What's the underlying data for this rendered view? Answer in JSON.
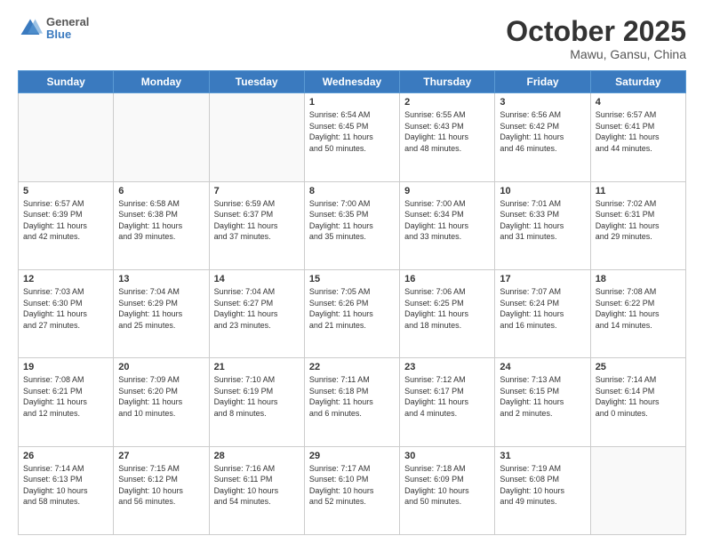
{
  "header": {
    "logo": {
      "line1": "General",
      "line2": "Blue"
    },
    "title": "October 2025",
    "location": "Mawu, Gansu, China"
  },
  "weekdays": [
    "Sunday",
    "Monday",
    "Tuesday",
    "Wednesday",
    "Thursday",
    "Friday",
    "Saturday"
  ],
  "weeks": [
    [
      {
        "day": "",
        "info": ""
      },
      {
        "day": "",
        "info": ""
      },
      {
        "day": "",
        "info": ""
      },
      {
        "day": "1",
        "info": "Sunrise: 6:54 AM\nSunset: 6:45 PM\nDaylight: 11 hours\nand 50 minutes."
      },
      {
        "day": "2",
        "info": "Sunrise: 6:55 AM\nSunset: 6:43 PM\nDaylight: 11 hours\nand 48 minutes."
      },
      {
        "day": "3",
        "info": "Sunrise: 6:56 AM\nSunset: 6:42 PM\nDaylight: 11 hours\nand 46 minutes."
      },
      {
        "day": "4",
        "info": "Sunrise: 6:57 AM\nSunset: 6:41 PM\nDaylight: 11 hours\nand 44 minutes."
      }
    ],
    [
      {
        "day": "5",
        "info": "Sunrise: 6:57 AM\nSunset: 6:39 PM\nDaylight: 11 hours\nand 42 minutes."
      },
      {
        "day": "6",
        "info": "Sunrise: 6:58 AM\nSunset: 6:38 PM\nDaylight: 11 hours\nand 39 minutes."
      },
      {
        "day": "7",
        "info": "Sunrise: 6:59 AM\nSunset: 6:37 PM\nDaylight: 11 hours\nand 37 minutes."
      },
      {
        "day": "8",
        "info": "Sunrise: 7:00 AM\nSunset: 6:35 PM\nDaylight: 11 hours\nand 35 minutes."
      },
      {
        "day": "9",
        "info": "Sunrise: 7:00 AM\nSunset: 6:34 PM\nDaylight: 11 hours\nand 33 minutes."
      },
      {
        "day": "10",
        "info": "Sunrise: 7:01 AM\nSunset: 6:33 PM\nDaylight: 11 hours\nand 31 minutes."
      },
      {
        "day": "11",
        "info": "Sunrise: 7:02 AM\nSunset: 6:31 PM\nDaylight: 11 hours\nand 29 minutes."
      }
    ],
    [
      {
        "day": "12",
        "info": "Sunrise: 7:03 AM\nSunset: 6:30 PM\nDaylight: 11 hours\nand 27 minutes."
      },
      {
        "day": "13",
        "info": "Sunrise: 7:04 AM\nSunset: 6:29 PM\nDaylight: 11 hours\nand 25 minutes."
      },
      {
        "day": "14",
        "info": "Sunrise: 7:04 AM\nSunset: 6:27 PM\nDaylight: 11 hours\nand 23 minutes."
      },
      {
        "day": "15",
        "info": "Sunrise: 7:05 AM\nSunset: 6:26 PM\nDaylight: 11 hours\nand 21 minutes."
      },
      {
        "day": "16",
        "info": "Sunrise: 7:06 AM\nSunset: 6:25 PM\nDaylight: 11 hours\nand 18 minutes."
      },
      {
        "day": "17",
        "info": "Sunrise: 7:07 AM\nSunset: 6:24 PM\nDaylight: 11 hours\nand 16 minutes."
      },
      {
        "day": "18",
        "info": "Sunrise: 7:08 AM\nSunset: 6:22 PM\nDaylight: 11 hours\nand 14 minutes."
      }
    ],
    [
      {
        "day": "19",
        "info": "Sunrise: 7:08 AM\nSunset: 6:21 PM\nDaylight: 11 hours\nand 12 minutes."
      },
      {
        "day": "20",
        "info": "Sunrise: 7:09 AM\nSunset: 6:20 PM\nDaylight: 11 hours\nand 10 minutes."
      },
      {
        "day": "21",
        "info": "Sunrise: 7:10 AM\nSunset: 6:19 PM\nDaylight: 11 hours\nand 8 minutes."
      },
      {
        "day": "22",
        "info": "Sunrise: 7:11 AM\nSunset: 6:18 PM\nDaylight: 11 hours\nand 6 minutes."
      },
      {
        "day": "23",
        "info": "Sunrise: 7:12 AM\nSunset: 6:17 PM\nDaylight: 11 hours\nand 4 minutes."
      },
      {
        "day": "24",
        "info": "Sunrise: 7:13 AM\nSunset: 6:15 PM\nDaylight: 11 hours\nand 2 minutes."
      },
      {
        "day": "25",
        "info": "Sunrise: 7:14 AM\nSunset: 6:14 PM\nDaylight: 11 hours\nand 0 minutes."
      }
    ],
    [
      {
        "day": "26",
        "info": "Sunrise: 7:14 AM\nSunset: 6:13 PM\nDaylight: 10 hours\nand 58 minutes."
      },
      {
        "day": "27",
        "info": "Sunrise: 7:15 AM\nSunset: 6:12 PM\nDaylight: 10 hours\nand 56 minutes."
      },
      {
        "day": "28",
        "info": "Sunrise: 7:16 AM\nSunset: 6:11 PM\nDaylight: 10 hours\nand 54 minutes."
      },
      {
        "day": "29",
        "info": "Sunrise: 7:17 AM\nSunset: 6:10 PM\nDaylight: 10 hours\nand 52 minutes."
      },
      {
        "day": "30",
        "info": "Sunrise: 7:18 AM\nSunset: 6:09 PM\nDaylight: 10 hours\nand 50 minutes."
      },
      {
        "day": "31",
        "info": "Sunrise: 7:19 AM\nSunset: 6:08 PM\nDaylight: 10 hours\nand 49 minutes."
      },
      {
        "day": "",
        "info": ""
      }
    ]
  ]
}
